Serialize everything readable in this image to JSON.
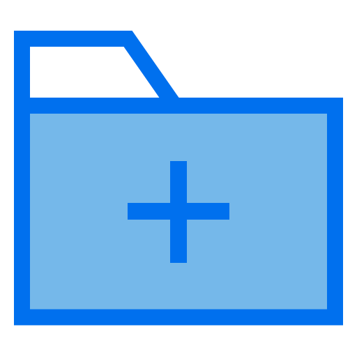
{
  "icon": {
    "name": "add-folder-icon",
    "semantic": "folder-plus",
    "colors": {
      "background": "#ffffff",
      "stroke": "#0070ee",
      "fill": "#75b8ea",
      "tab_fill": "#ffffff"
    }
  }
}
